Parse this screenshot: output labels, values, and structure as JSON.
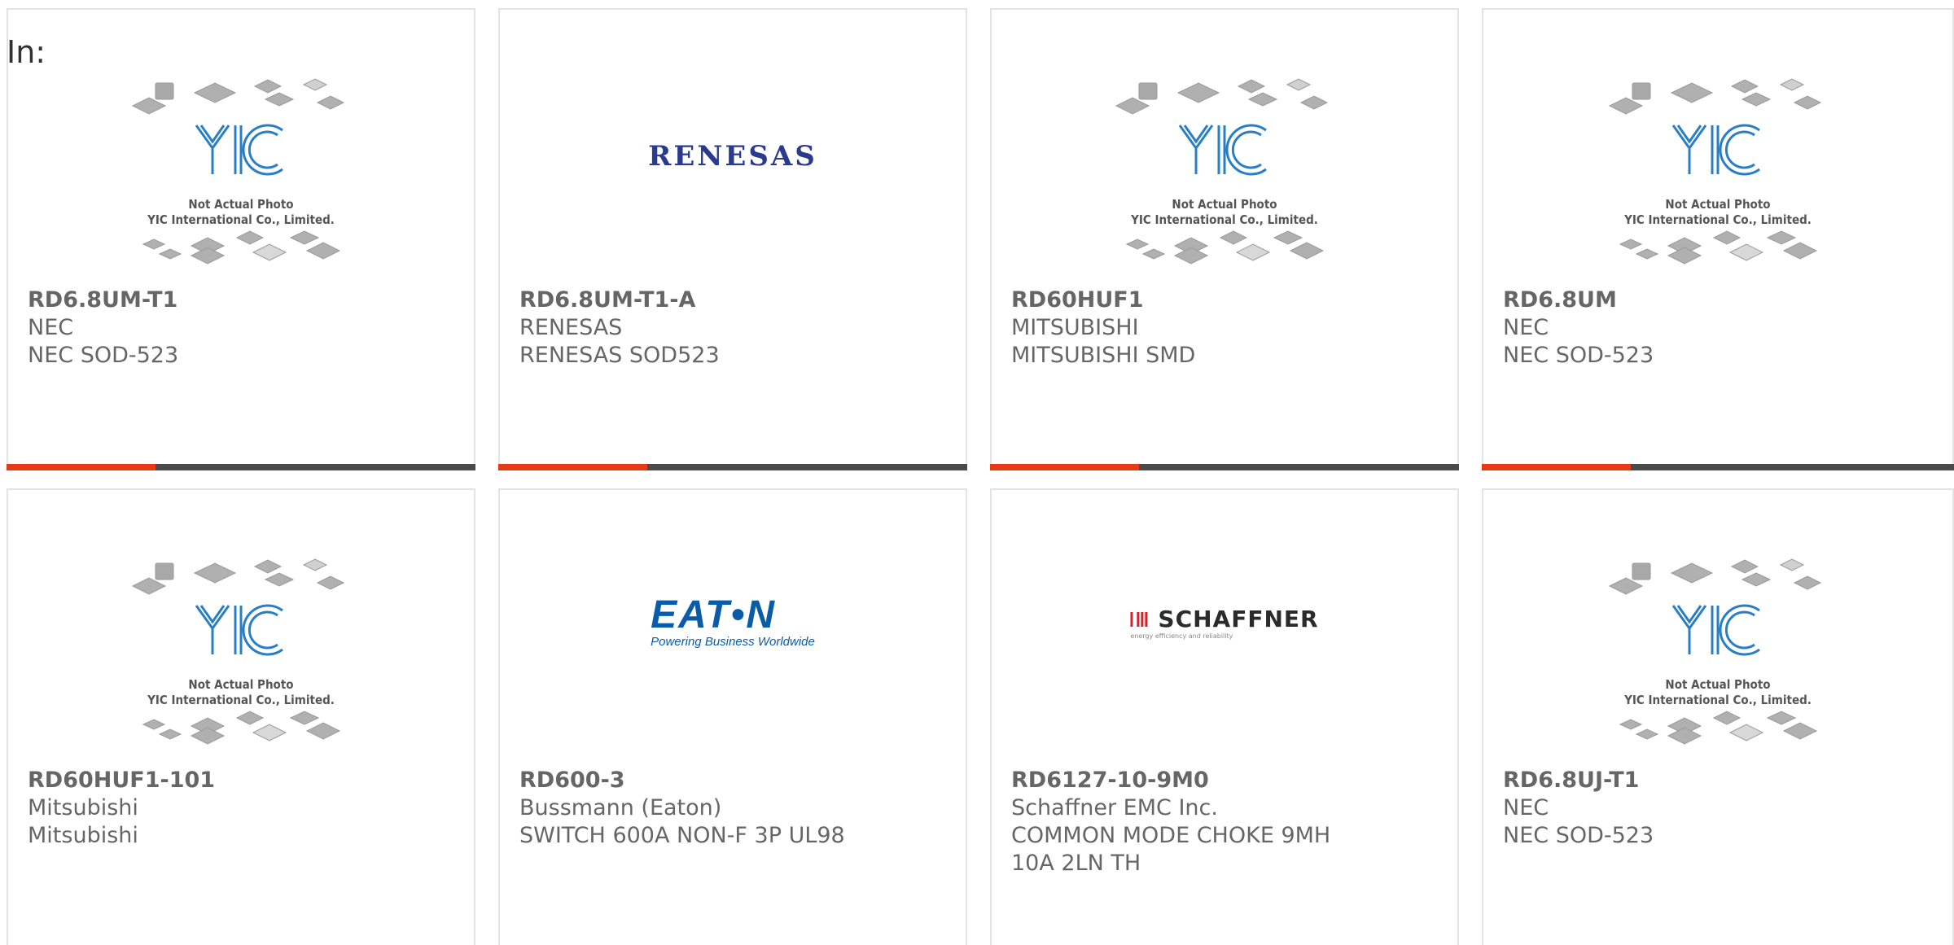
{
  "header": {
    "in_label": "In:"
  },
  "placeholder": {
    "line1": "Not Actual Photo",
    "line2": "YIC International Co., Limited."
  },
  "logos": {
    "renesas": "RENESAS",
    "eaton": "EAT•N",
    "eaton_tagline": "Powering Business Worldwide",
    "schaffner": "SCHAFFNER",
    "schaffner_tagline": "energy efficiency and reliability"
  },
  "colors": {
    "accent": "#e63a16",
    "bar": "#4a4a4a",
    "text": "#666666",
    "yic_blue": "#2a7fc4"
  },
  "products": [
    {
      "part": "RD6.8UM-T1",
      "brand": "NEC",
      "desc": "NEC SOD-523",
      "image": "yic-placeholder"
    },
    {
      "part": "RD6.8UM-T1-A",
      "brand": "RENESAS",
      "desc": "RENESAS SOD523",
      "image": "renesas-logo"
    },
    {
      "part": "RD60HUF1",
      "brand": "MITSUBISHI",
      "desc": "MITSUBISHI SMD",
      "image": "yic-placeholder"
    },
    {
      "part": "RD6.8UM",
      "brand": "NEC",
      "desc": "NEC SOD-523",
      "image": "yic-placeholder"
    },
    {
      "part": "RD60HUF1-101",
      "brand": "Mitsubishi",
      "desc": "Mitsubishi",
      "image": "yic-placeholder"
    },
    {
      "part": "RD600-3",
      "brand": "Bussmann (Eaton)",
      "desc": "SWITCH 600A NON-F 3P UL98",
      "image": "eaton-logo"
    },
    {
      "part": "RD6127-10-9M0",
      "brand": "Schaffner EMC Inc.",
      "desc": "COMMON MODE CHOKE 9MH 10A 2LN TH",
      "image": "schaffner-logo"
    },
    {
      "part": "RD6.8UJ-T1",
      "brand": "NEC",
      "desc": "NEC SOD-523",
      "image": "yic-placeholder"
    }
  ]
}
